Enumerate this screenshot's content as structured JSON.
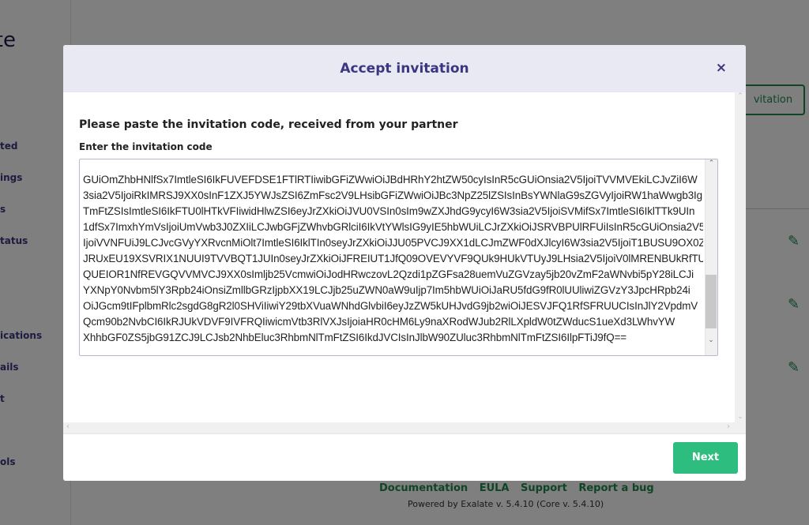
{
  "background": {
    "logo_fragment": "te",
    "sidebar_fragments": [
      "ted",
      "ings",
      "s",
      "tatus",
      "ications",
      "ails",
      "t",
      "ols"
    ],
    "invitation_button_fragment": "vitation",
    "footer_links": [
      "Documentation",
      "EULA",
      "Support",
      "Report a bug"
    ],
    "powered_by": "Powered by Exalate v. 5.4.10 (Core v. 5.4.10)"
  },
  "modal": {
    "title": "Accept invitation",
    "close_icon": "×",
    "heading": "Please paste the invitation code, received from your partner",
    "field_label": "Enter the invitation code",
    "code_lines": [
      "GUiOmZhbHNlfSx7ImtleSI6IkFUVEFDSE1FTlRTIiwibGFiZWwiOiJBdHRhY2htZW50cyIsInR5cGUiOnsia2V5IjoiTVVMVEkiLCJvZiI6W",
      "3sia2V5IjoiRkIMRSJ9XX0sInF1ZXJ5YWJsZSI6ZmFsc2V9LHsibGFiZWwiOiJBc3NpZ25lZSIsInBsYWNlaG9sZGVyIjoiRW1haWwgb3Ig",
      "TmFtZSIsImtleSI6IkFTU0lHTkVFIiwidHlwZSI6eyJrZXkiOiJVU0VSIn0sIm9wZXJhdG9ycyI6W3sia2V5IjoiSVMifSx7ImtleSI6IklTTk9UIn",
      "1dfSx7ImxhYmVsIjoiUmVwb3J0ZXIiLCJwbGFjZWhvbGRlciI6IkVtYWlsIG9yIE5hbWUiLCJrZXkiOiJSRVBPUlRFUiIsInR5cGUiOnsia2V5",
      "IjoiVVNFUiJ9LCJvcGVyYXRvcnMiOlt7ImtleSI6IklTIn0seyJrZXkiOiJJU05PVCJ9XX1dLCJmZWF0dXJlcyI6W3sia2V5IjoiT1BUSU9OX0Z",
      "JRUxEU19XSVRIX1NUUI9TVVBQT1JUIn0seyJrZXkiOiJFREIUT1JfQ09OVEVYVF9QUk9HUkVTUyJ9LHsia2V5IjoiV0lMRENBUkRfTUF",
      "QUEIOR1NfREVGQVVMVCJ9XX0sImljb25VcmwiOiJodHRwczovL2Qzdi1pZGFsa28uemVuZGVzay5jb20vZmF2aWNvbi5pY28iLCJi",
      "YXNpY0Nvbm5lY3Rpb24iOnsiZmllbGRzIjpbXX19LCJjb25uZWN0aW9uIjp7Im5hbWUiOiJaRU5fdG9fR0lUUliwiZGVzY3JpcHRpb24i",
      "OiJGcm9tIFplbmRlc2sgdG8gR2l0SHViIiwiY29tbXVuaWNhdGlvbiI6eyJzZW5kUHJvdG9jb2wiOiJESVJFQ1RfSFRUUCIsInJlY2VpdmV",
      "Qcm90b2NvbCI6IkRJUkVDVF9IVFRQIiwicmVtb3RlVXJsIjoiaHR0cHM6Ly9naXRodWJub2RlLXpldW0tZWducS1ueXd3LWhvYW",
      "XhhbGF0ZS5jbG91ZCJ9LCJsb2NhbEluc3RhbmNlTmFtZSI6IkdJVCIsInJlbW90ZUluc3RhbmNlTmFtZSI6IlpFTiJ9fQ=="
    ],
    "next_label": "Next"
  },
  "colors": {
    "accent": "#3b3680",
    "primary_button": "#2dbd7e",
    "link": "#1e8a4c"
  }
}
